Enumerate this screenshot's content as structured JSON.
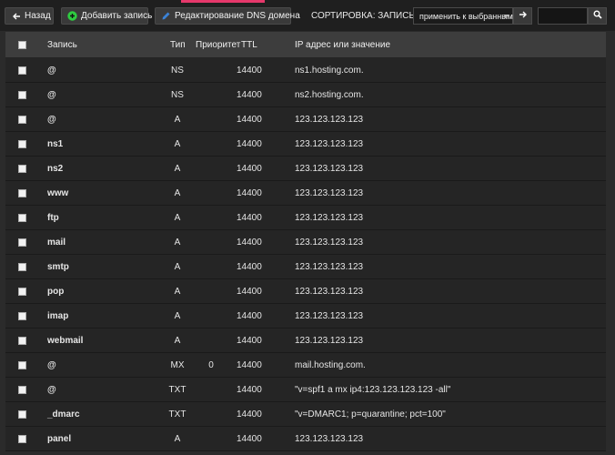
{
  "toolbar": {
    "back_label": "Назад",
    "add_label": "Добавить запись",
    "edit_label": "Редактирование DNS домена",
    "sort_label": "СОРТИРОВКА:",
    "sort_field": "ЗАПИСЬ",
    "select_value": "применить к выбранным",
    "search_value": ""
  },
  "colors": {
    "accent": "#e6386b",
    "add_icon": "#2ecc40",
    "edit_icon": "#3b82d6"
  },
  "table": {
    "headers": {
      "name": "Запись",
      "type": "Тип",
      "priority": "Приоритет",
      "ttl": "TTL",
      "value": "IP адрес или значение"
    },
    "rows": [
      {
        "name": "@",
        "type": "NS",
        "priority": "",
        "ttl": "14400",
        "value": "ns1.hosting.com."
      },
      {
        "name": "@",
        "type": "NS",
        "priority": "",
        "ttl": "14400",
        "value": "ns2.hosting.com."
      },
      {
        "name": "@",
        "type": "A",
        "priority": "",
        "ttl": "14400",
        "value": "123.123.123.123"
      },
      {
        "name": "ns1",
        "type": "A",
        "priority": "",
        "ttl": "14400",
        "value": "123.123.123.123"
      },
      {
        "name": "ns2",
        "type": "A",
        "priority": "",
        "ttl": "14400",
        "value": "123.123.123.123"
      },
      {
        "name": "www",
        "type": "A",
        "priority": "",
        "ttl": "14400",
        "value": "123.123.123.123"
      },
      {
        "name": "ftp",
        "type": "A",
        "priority": "",
        "ttl": "14400",
        "value": "123.123.123.123"
      },
      {
        "name": "mail",
        "type": "A",
        "priority": "",
        "ttl": "14400",
        "value": "123.123.123.123"
      },
      {
        "name": "smtp",
        "type": "A",
        "priority": "",
        "ttl": "14400",
        "value": "123.123.123.123"
      },
      {
        "name": "pop",
        "type": "A",
        "priority": "",
        "ttl": "14400",
        "value": "123.123.123.123"
      },
      {
        "name": "imap",
        "type": "A",
        "priority": "",
        "ttl": "14400",
        "value": "123.123.123.123"
      },
      {
        "name": "webmail",
        "type": "A",
        "priority": "",
        "ttl": "14400",
        "value": "123.123.123.123"
      },
      {
        "name": "@",
        "type": "MX",
        "priority": "0",
        "ttl": "14400",
        "value": "mail.hosting.com."
      },
      {
        "name": "@",
        "type": "TXT",
        "priority": "",
        "ttl": "14400",
        "value": "\"v=spf1 a mx ip4:123.123.123.123 -all\""
      },
      {
        "name": "_dmarc",
        "type": "TXT",
        "priority": "",
        "ttl": "14400",
        "value": "\"v=DMARC1; p=quarantine; pct=100\""
      },
      {
        "name": "panel",
        "type": "A",
        "priority": "",
        "ttl": "14400",
        "value": "123.123.123.123"
      }
    ]
  }
}
